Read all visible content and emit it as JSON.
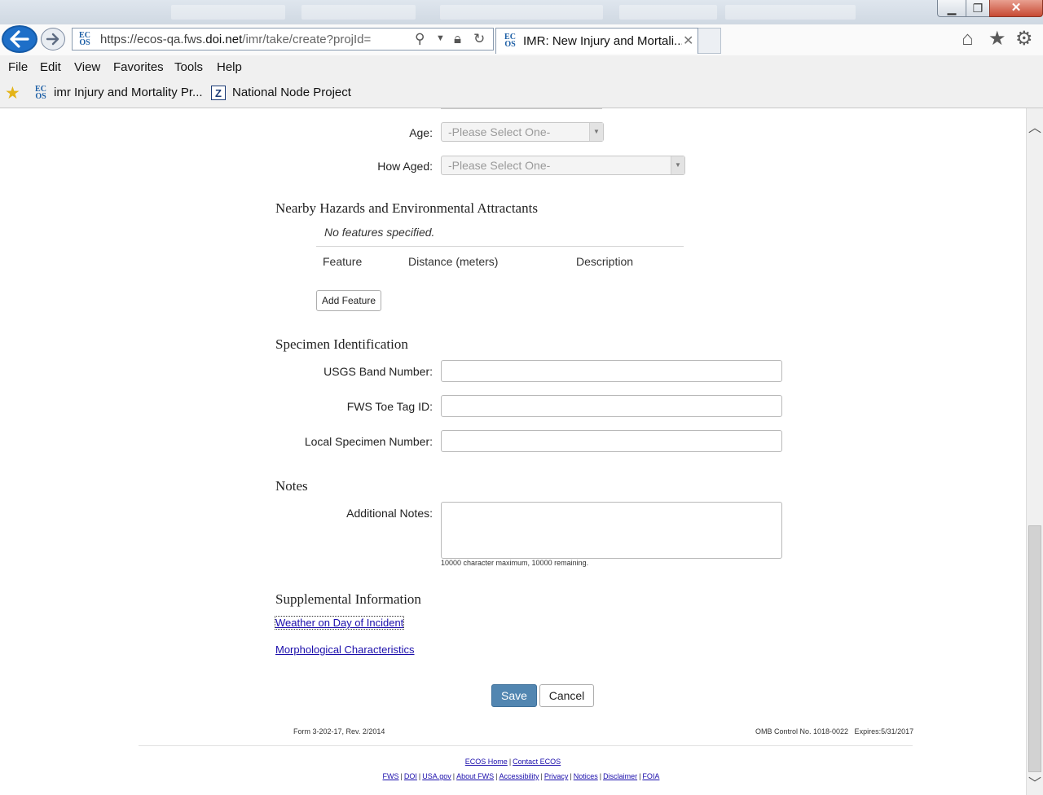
{
  "browser": {
    "url": {
      "scheme": "https://",
      "sub": "ecos-qa.fws.",
      "host": "doi.net",
      "path": "/imr/take/create?projId="
    },
    "tab_title": "IMR: New Injury and Mortali...",
    "menu": [
      "File",
      "Edit",
      "View",
      "Favorites",
      "Tools",
      "Help"
    ],
    "favorites": [
      {
        "label": "imr Injury and Mortality Pr..."
      },
      {
        "label": "National Node Project"
      }
    ],
    "logo_text": "EC\nOS"
  },
  "form": {
    "age": {
      "label": "Age:",
      "value": "-Please Select One-"
    },
    "how_aged": {
      "label": "How Aged:",
      "value": "-Please Select One-"
    },
    "hazards": {
      "title": "Nearby Hazards and Environmental Attractants",
      "empty_text": "No features specified.",
      "columns": [
        "Feature",
        "Distance (meters)",
        "Description"
      ],
      "add_button": "Add Feature"
    },
    "specimen": {
      "title": "Specimen Identification",
      "usgs_label": "USGS Band Number:",
      "usgs_value": "",
      "toe_label": "FWS Toe Tag ID:",
      "toe_value": "",
      "local_label": "Local Specimen Number:",
      "local_value": ""
    },
    "notes": {
      "title": "Notes",
      "label": "Additional Notes:",
      "value": "",
      "counter": "10000 character maximum, 10000 remaining."
    },
    "supplemental": {
      "title": "Supplemental Information",
      "links": [
        "Weather on Day of Incident",
        "Morphological Characteristics"
      ]
    },
    "save_label": "Save",
    "cancel_label": "Cancel"
  },
  "footer": {
    "form_number": "Form 3-202-17, Rev. 2/2014",
    "omb": "OMB Control No. 1018-0022   Expires:5/31/2017",
    "row1": [
      "ECOS Home",
      "Contact ECOS"
    ],
    "row2": [
      "FWS",
      "DOI",
      "USA.gov",
      "About FWS",
      "Accessibility",
      "Privacy",
      "Notices",
      "Disclaimer",
      "FOIA"
    ]
  },
  "colors": {
    "accent": "#5286b1",
    "link": "#1a0dab",
    "ie_blue": "#1e6fc8"
  }
}
